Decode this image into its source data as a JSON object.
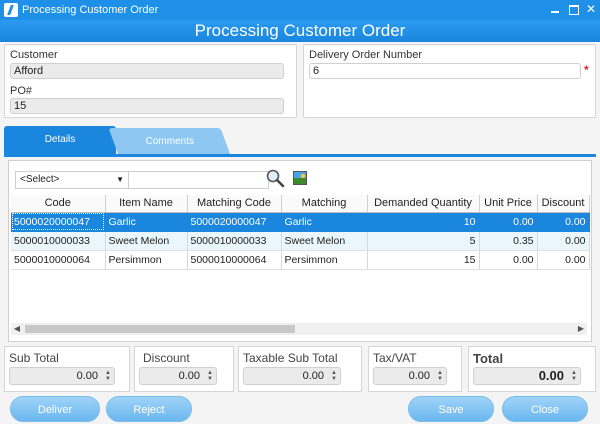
{
  "window": {
    "title": "Processing Customer Order"
  },
  "banner": {
    "title": "Processing Customer Order"
  },
  "customer": {
    "label": "Customer",
    "value": "Afford"
  },
  "po": {
    "label": "PO#",
    "value": "15"
  },
  "delivery": {
    "label": "Delivery Order Number",
    "value": "6",
    "required_mark": "*"
  },
  "tabs": [
    {
      "label": "Details"
    },
    {
      "label": "Comments"
    }
  ],
  "toolbar": {
    "select_value": "<Select>",
    "search_value": ""
  },
  "table": {
    "columns": [
      "Code",
      "Item Name",
      "Matching Code",
      "Matching",
      "Demanded Quantity",
      "Unit Price",
      "Discount"
    ],
    "rows": [
      {
        "code": "5000020000047",
        "item": "Garlic",
        "match_code": "5000020000047",
        "matching": "Garlic",
        "qty": "10",
        "price": "0.00",
        "discount": "0.00"
      },
      {
        "code": "5000010000033",
        "item": "Sweet Melon",
        "match_code": "5000010000033",
        "matching": "Sweet Melon",
        "qty": "5",
        "price": "0.35",
        "discount": "0.00"
      },
      {
        "code": "5000010000064",
        "item": "Persimmon",
        "match_code": "5000010000064",
        "matching": "Persimmon",
        "qty": "15",
        "price": "0.00",
        "discount": "0.00"
      }
    ]
  },
  "totals": {
    "sub_total": {
      "label": "Sub Total",
      "value": "0.00"
    },
    "discount": {
      "label": "Discount",
      "value": "0.00"
    },
    "taxable": {
      "label": "Taxable Sub Total",
      "value": "0.00"
    },
    "tax": {
      "label": "Tax/VAT",
      "value": "0.00"
    },
    "total": {
      "label": "Total",
      "value": "0.00"
    }
  },
  "buttons": {
    "deliver": "Deliver",
    "reject": "Reject",
    "save": "Save",
    "close": "Close"
  }
}
